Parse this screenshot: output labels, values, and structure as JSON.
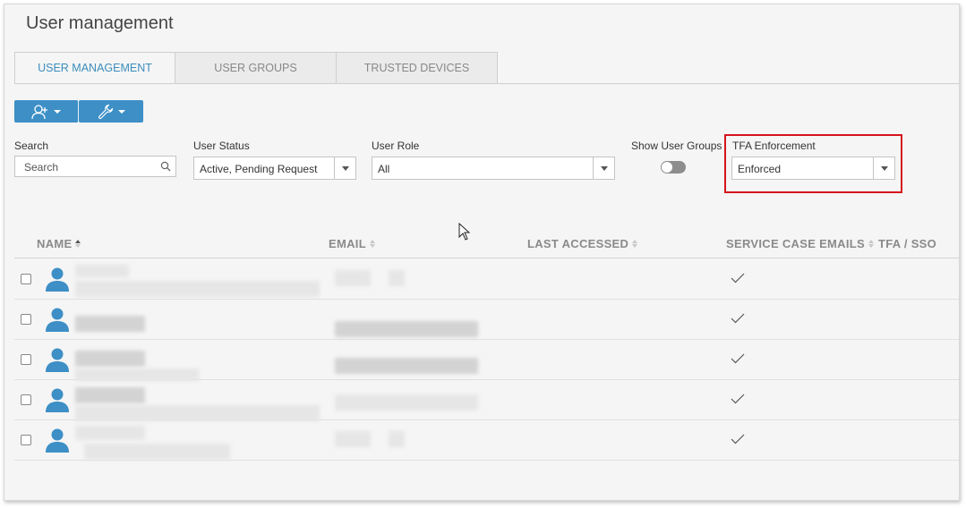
{
  "page": {
    "title": "User management"
  },
  "tabs": [
    {
      "label": "USER MANAGEMENT",
      "active": true
    },
    {
      "label": "USER GROUPS",
      "active": false
    },
    {
      "label": "TRUSTED DEVICES",
      "active": false
    }
  ],
  "toolbar": {
    "buttons": [
      {
        "icon": "add-user-icon"
      },
      {
        "icon": "wrench-icon"
      }
    ]
  },
  "filters": {
    "search": {
      "label": "Search",
      "placeholder": "Search"
    },
    "user_status": {
      "label": "User Status",
      "value": "Active, Pending Request"
    },
    "user_role": {
      "label": "User Role",
      "value": "All"
    },
    "show_user_groups": {
      "label": "Show User Groups",
      "on": false
    },
    "tfa_enforcement": {
      "label": "TFA Enforcement",
      "value": "Enforced"
    }
  },
  "table": {
    "columns": [
      "NAME",
      "EMAIL",
      "LAST ACCESSED",
      "SERVICE CASE EMAILS",
      "TFA / SSO"
    ],
    "rows": [
      {
        "service_case_emails": true
      },
      {
        "service_case_emails": true
      },
      {
        "service_case_emails": true
      },
      {
        "service_case_emails": true
      },
      {
        "service_case_emails": true
      }
    ]
  },
  "colors": {
    "accent": "#3d8fc6",
    "highlight": "#d4141b",
    "tab_active_text": "#3c8dbc"
  }
}
